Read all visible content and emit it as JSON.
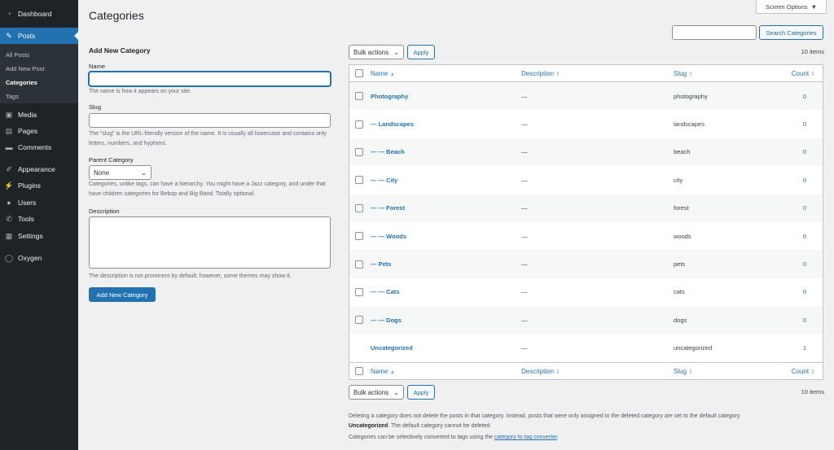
{
  "sidebar": {
    "items": [
      {
        "label": "Dashboard",
        "icon": "dashboard-icon",
        "glyph": "◔"
      },
      {
        "label": "Posts",
        "icon": "pin-icon",
        "glyph": "✎",
        "current": true
      },
      {
        "label": "Media",
        "icon": "media-icon",
        "glyph": "▣"
      },
      {
        "label": "Pages",
        "icon": "pages-icon",
        "glyph": "▤"
      },
      {
        "label": "Comments",
        "icon": "comment-icon",
        "glyph": "▬"
      },
      {
        "label": "Appearance",
        "icon": "appearance-icon",
        "glyph": "✐"
      },
      {
        "label": "Plugins",
        "icon": "plugin-icon",
        "glyph": "⚡"
      },
      {
        "label": "Users",
        "icon": "user-icon",
        "glyph": "●"
      },
      {
        "label": "Tools",
        "icon": "wrench-icon",
        "glyph": "✆"
      },
      {
        "label": "Settings",
        "icon": "settings-icon",
        "glyph": "▦"
      },
      {
        "label": "Oxygen",
        "icon": "oxygen-icon",
        "glyph": "◯"
      }
    ],
    "submenu": [
      "All Posts",
      "Add New Post",
      "Categories",
      "Tags"
    ]
  },
  "header": {
    "title": "Categories",
    "screen_options": "Screen Options"
  },
  "form": {
    "heading": "Add New Category",
    "name_label": "Name",
    "name_value": "",
    "name_hint": "The name is how it appears on your site.",
    "slug_label": "Slug",
    "slug_value": "",
    "slug_hint": "The “slug” is the URL-friendly version of the name. It is usually all lowercase and contains only letters, numbers, and hyphens.",
    "parent_label": "Parent Category",
    "parent_value": "None",
    "parent_hint": "Categories, unlike tags, can have a hierarchy. You might have a Jazz category, and under that have children categories for Bebop and Big Band. Totally optional.",
    "desc_label": "Description",
    "desc_value": "",
    "desc_hint": "The description is not prominent by default; however, some themes may show it.",
    "submit": "Add New Category"
  },
  "search": {
    "value": "",
    "button": "Search Categories"
  },
  "bulk": {
    "select": "Bulk actions",
    "apply": "Apply",
    "count": "10 items"
  },
  "table": {
    "columns": {
      "name": "Name",
      "description": "Description",
      "slug": "Slug",
      "count": "Count"
    },
    "rows": [
      {
        "name": "Photography",
        "description": "—",
        "slug": "photography",
        "count": "0"
      },
      {
        "name": "— Landscapes",
        "description": "—",
        "slug": "landscapes",
        "count": "0"
      },
      {
        "name": "— — Beach",
        "description": "—",
        "slug": "beach",
        "count": "0"
      },
      {
        "name": "— — City",
        "description": "—",
        "slug": "city",
        "count": "0"
      },
      {
        "name": "— — Forest",
        "description": "—",
        "slug": "forest",
        "count": "0"
      },
      {
        "name": "— — Woods",
        "description": "—",
        "slug": "woods",
        "count": "0"
      },
      {
        "name": "— Pets",
        "description": "—",
        "slug": "pets",
        "count": "0"
      },
      {
        "name": "— — Cats",
        "description": "—",
        "slug": "cats",
        "count": "0"
      },
      {
        "name": "— — Dogs",
        "description": "—",
        "slug": "dogs",
        "count": "0"
      },
      {
        "name": "Uncategorized",
        "description": "—",
        "slug": "uncategorized",
        "count": "1",
        "no_checkbox": true
      }
    ]
  },
  "notes": {
    "line1": "Deleting a category does not delete the posts in that category. Instead, posts that were only assigned to the deleted category are set to the default category",
    "line2_bold": "Uncategorized",
    "line2_rest": ". The default category cannot be deleted.",
    "line3_pre": "Categories can be selectively converted to tags using the ",
    "line3_link": "category to tag converter",
    "line3_post": "."
  },
  "colors": {
    "accent": "#2271b1",
    "sidebar": "#1d2327"
  }
}
